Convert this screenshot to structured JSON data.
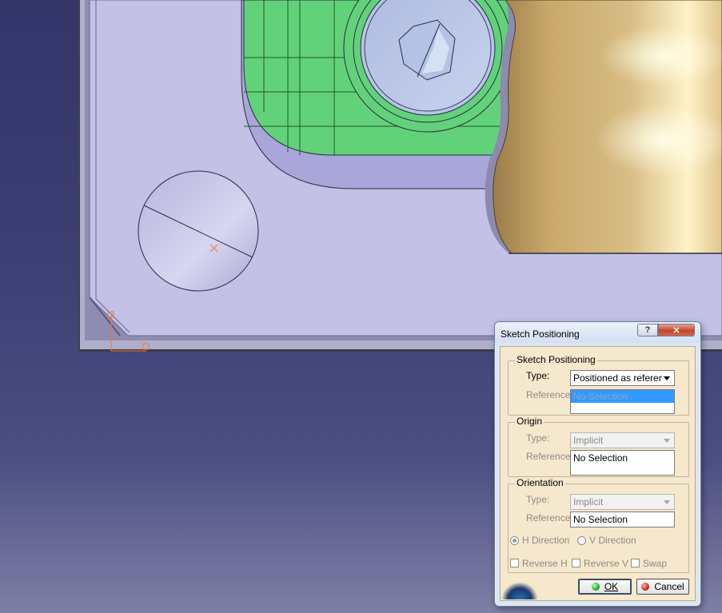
{
  "dialog": {
    "title": "Sketch Positioning",
    "help_label": "?",
    "close_label": "✕",
    "sketch_positioning": {
      "group_label": "Sketch Positioning",
      "type_label": "Type:",
      "type_value": "Positioned as referer",
      "reference_label": "Reference:",
      "reference_items": [
        "No Selection"
      ]
    },
    "origin": {
      "group_label": "Origin",
      "type_label": "Type:",
      "type_value": "Implicit",
      "reference_label": "Reference:",
      "reference_value": "No Selection"
    },
    "orientation": {
      "group_label": "Orientation",
      "type_label": "Type:",
      "type_value": "Implicit",
      "reference_label": "Reference:",
      "reference_value": "No Selection",
      "h_direction_label": "H Direction",
      "v_direction_label": "V Direction",
      "reverse_h_label": "Reverse H",
      "reverse_v_label": "Reverse V",
      "swap_label": "Swap"
    },
    "ok_label": "OK",
    "cancel_label": "Cancel"
  },
  "colors": {
    "part_face": "#c4c0e6",
    "pocket_face": "#62d27a",
    "gold_surface": "#c9a96b",
    "background_top": "#33356a",
    "background_bottom": "#7f7fa6",
    "axis_orange": "#f07a2a"
  }
}
